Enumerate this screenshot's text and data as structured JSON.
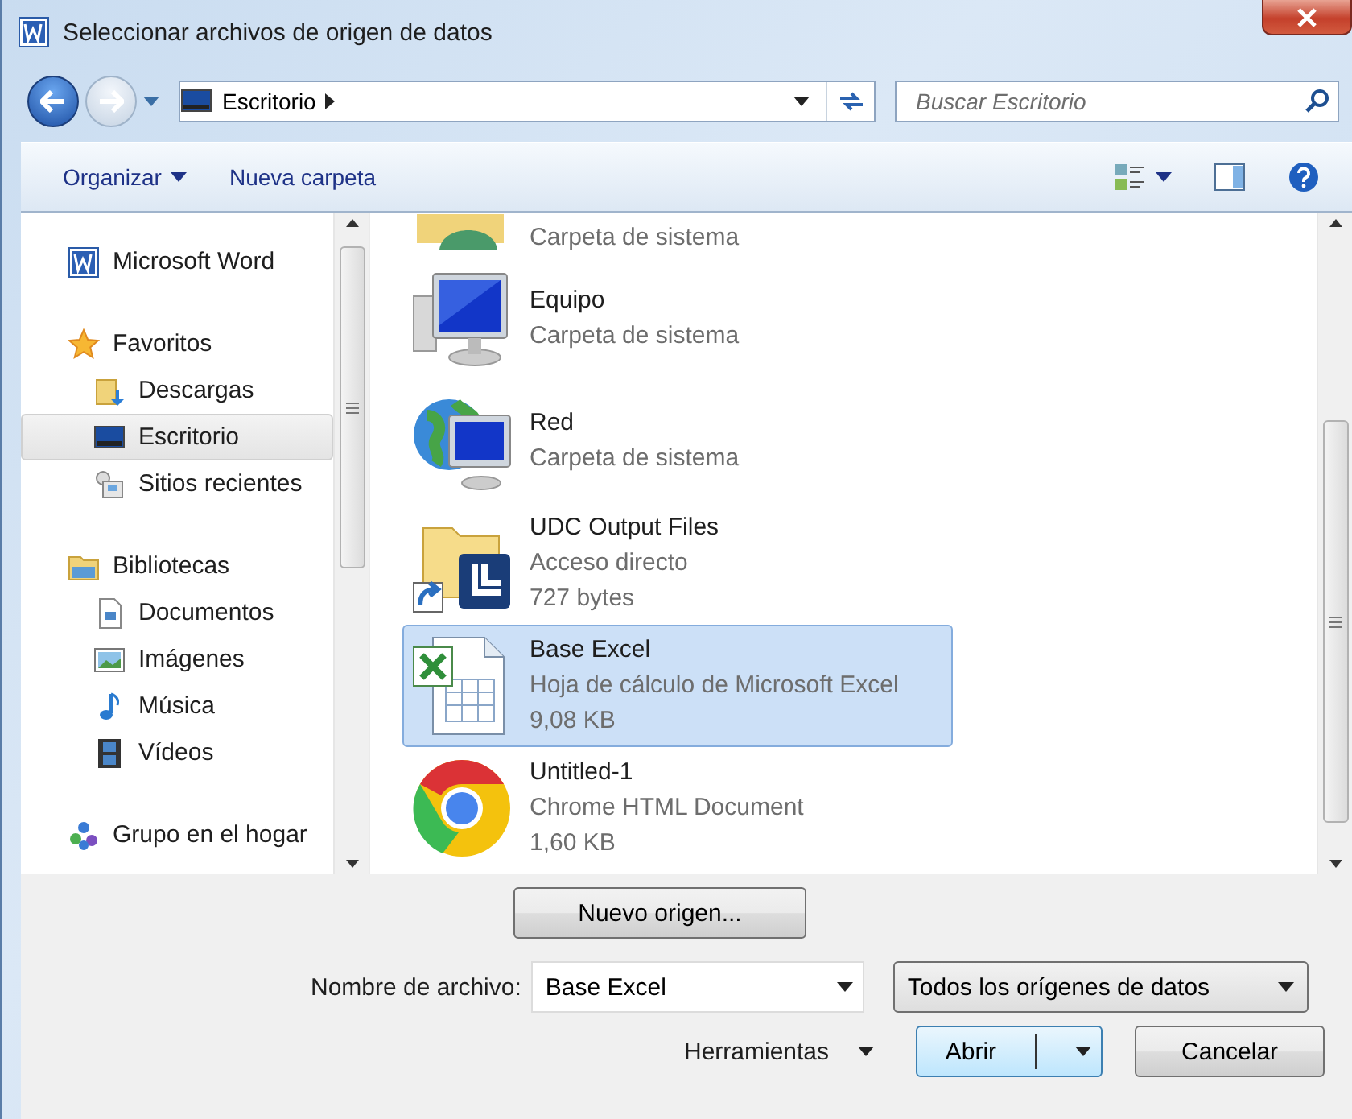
{
  "window": {
    "title": "Seleccionar archivos de origen de datos"
  },
  "address": {
    "location": "Escritorio",
    "search_placeholder": "Buscar Escritorio"
  },
  "toolbar": {
    "organize": "Organizar",
    "new_folder": "Nueva carpeta"
  },
  "sidebar": {
    "groups": [
      {
        "label": "Microsoft Word",
        "kind": "word"
      },
      {
        "label": "Favoritos",
        "kind": "star",
        "children": [
          {
            "label": "Descargas",
            "kind": "downloads",
            "selected": false
          },
          {
            "label": "Escritorio",
            "kind": "desktop",
            "selected": true
          },
          {
            "label": "Sitios recientes",
            "kind": "recent",
            "selected": false
          }
        ]
      },
      {
        "label": "Bibliotecas",
        "kind": "library",
        "children": [
          {
            "label": "Documentos",
            "kind": "documents",
            "selected": false
          },
          {
            "label": "Imágenes",
            "kind": "pictures",
            "selected": false
          },
          {
            "label": "Música",
            "kind": "music",
            "selected": false
          },
          {
            "label": "Vídeos",
            "kind": "videos",
            "selected": false
          }
        ]
      },
      {
        "label": "Grupo en el hogar",
        "kind": "homegroup"
      }
    ]
  },
  "files": [
    {
      "kind": "user",
      "lines": [
        "Carpeta de sistema"
      ],
      "selected": false
    },
    {
      "kind": "computer",
      "name": "Equipo",
      "lines": [
        "Carpeta de sistema"
      ],
      "selected": false
    },
    {
      "kind": "network",
      "name": "Red",
      "lines": [
        "Carpeta de sistema"
      ],
      "selected": false
    },
    {
      "kind": "shortcut",
      "name": "UDC Output Files",
      "lines": [
        "Acceso directo",
        "727 bytes"
      ],
      "selected": false
    },
    {
      "kind": "excel",
      "name": "Base Excel",
      "lines": [
        "Hoja de cálculo de Microsoft Excel",
        "9,08 KB"
      ],
      "selected": true
    },
    {
      "kind": "chrome",
      "name": "Untitled-1",
      "lines": [
        "Chrome HTML Document",
        "1,60 KB"
      ],
      "selected": false
    }
  ],
  "footer": {
    "new_source": "Nuevo origen...",
    "filename_label": "Nombre de archivo:",
    "filename": "Base Excel",
    "filter": "Todos los orígenes de datos",
    "tools": "Herramientas",
    "open": "Abrir",
    "cancel": "Cancelar"
  }
}
